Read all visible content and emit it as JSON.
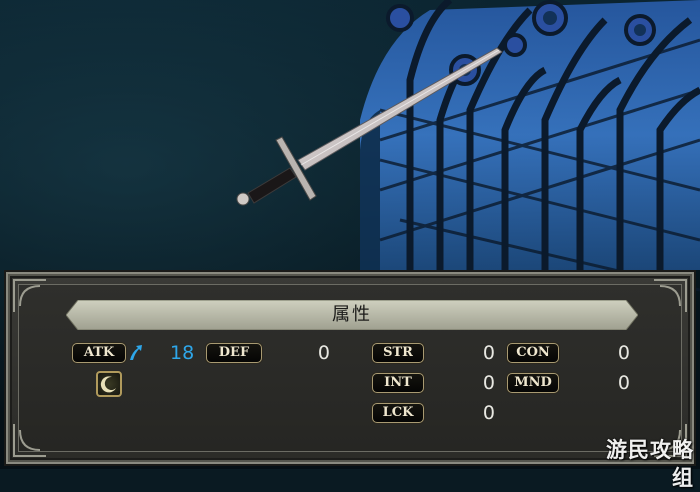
{
  "panel": {
    "title": "属性"
  },
  "stats": {
    "atk": {
      "label": "ATK",
      "value": "18",
      "indicator": "up-arrow-icon",
      "indicator_color": "#2ea7ea"
    },
    "def": {
      "label": "DEF",
      "value": "0"
    },
    "str": {
      "label": "STR",
      "value": "0"
    },
    "con": {
      "label": "CON",
      "value": "0"
    },
    "int": {
      "label": "INT",
      "value": "0"
    },
    "mnd": {
      "label": "MND",
      "value": "0"
    },
    "lck": {
      "label": "LCK",
      "value": "0"
    }
  },
  "element_icon": "crescent-moon-icon",
  "watermark": "游民攻略组",
  "colors": {
    "stat_increase": "#2ea7ea",
    "badge_border": "#a89a72",
    "panel_bg": "#2b2b28",
    "title_bar": "#b7b8a6"
  }
}
